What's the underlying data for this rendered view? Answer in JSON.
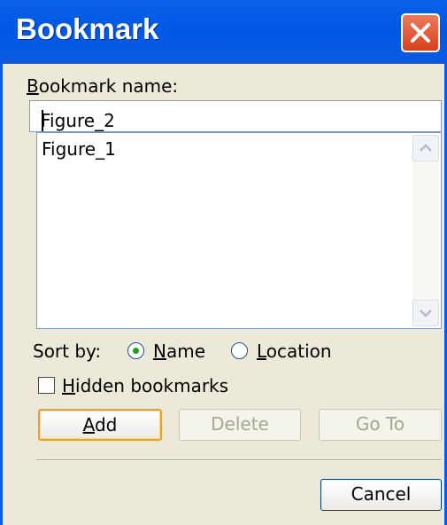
{
  "dialog": {
    "title": "Bookmark",
    "name_label_prefix": "B",
    "name_label_rest": "ookmark name:",
    "name_value": "Figure_2",
    "list_items": [
      "Figure_1"
    ],
    "sort_by_label": "Sort by:",
    "sort_options": [
      {
        "u": "N",
        "rest": "ame",
        "selected": true
      },
      {
        "u": "L",
        "rest": "ocation",
        "selected": false
      }
    ],
    "hidden_u": "H",
    "hidden_rest": "idden bookmarks",
    "hidden_checked": false,
    "add_u": "A",
    "add_rest": "dd",
    "delete_label": "Delete",
    "goto_label": "Go To",
    "cancel_label": "Cancel"
  },
  "colors": {
    "title_bar": "#0058e6",
    "window_bg": "#ece9d8",
    "close_button": "#d6401d",
    "default_button_border": "#e5a138",
    "radio_dot": "#21a121"
  },
  "icons": [
    "close-icon",
    "scroll-up-icon",
    "scroll-down-icon"
  ]
}
